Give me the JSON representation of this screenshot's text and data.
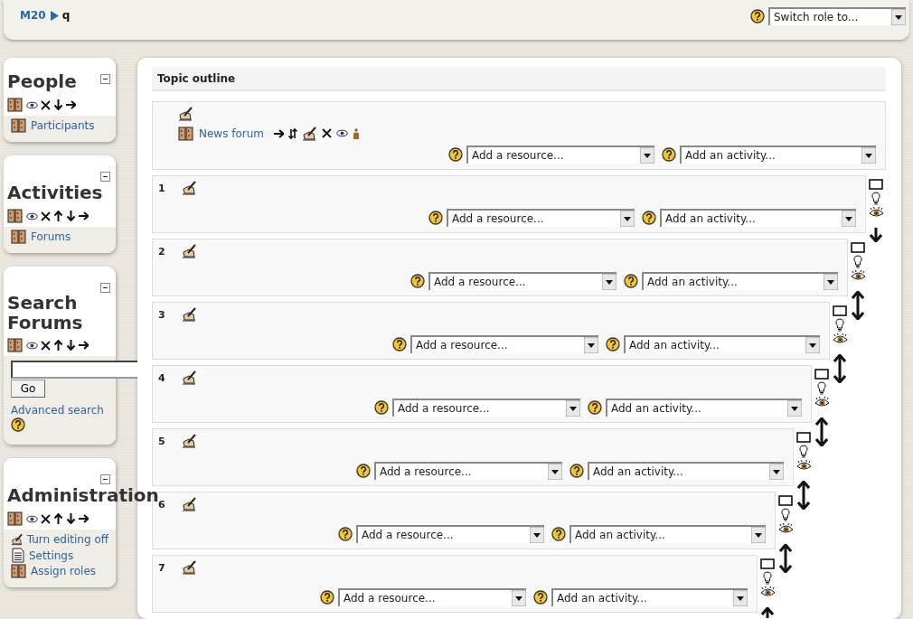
{
  "breadcrumb": [
    {
      "label": "M20",
      "kind": "link"
    },
    {
      "label": "q",
      "kind": "current"
    }
  ],
  "switch_role": {
    "value": "Switch role to..."
  },
  "blocks": [
    {
      "title": "People",
      "kind": "list",
      "items": [
        {
          "label": "Participants",
          "kind": "people"
        }
      ]
    },
    {
      "title": "Activities",
      "kind": "list",
      "items": [
        {
          "label": "Forums",
          "kind": "people"
        }
      ]
    },
    {
      "title": "Search Forums",
      "kind": "search",
      "button": "Go",
      "link": "Advanced search"
    },
    {
      "title": "Administration",
      "kind": "list",
      "items": [
        {
          "label": "Turn editing off",
          "kind": "edit"
        },
        {
          "label": "Settings",
          "kind": "document"
        },
        {
          "label": "Assign roles",
          "kind": "people"
        }
      ]
    }
  ],
  "topic_outline": {
    "title": "Topic outline",
    "sections": [
      {
        "kind": "general",
        "activities": [
          {
            "label": "News forum"
          }
        ],
        "resource_select": "Add a resource...",
        "activity_select": "Add an activity..."
      },
      {
        "kind": "topic",
        "number": "1",
        "resource_select": "Add a resource...",
        "activity_select": "Add an activity..."
      },
      {
        "kind": "topic",
        "number": "2",
        "resource_select": "Add a resource...",
        "activity_select": "Add an activity..."
      },
      {
        "kind": "topic",
        "number": "3",
        "resource_select": "Add a resource...",
        "activity_select": "Add an activity..."
      },
      {
        "kind": "topic",
        "number": "4",
        "resource_select": "Add a resource...",
        "activity_select": "Add an activity..."
      },
      {
        "kind": "topic",
        "number": "5",
        "resource_select": "Add a resource...",
        "activity_select": "Add an activity..."
      },
      {
        "kind": "topic",
        "number": "6",
        "resource_select": "Add a resource...",
        "activity_select": "Add an activity..."
      },
      {
        "kind": "topic",
        "number": "7",
        "resource_select": "Add a resource...",
        "activity_select": "Add an activity..."
      }
    ]
  }
}
